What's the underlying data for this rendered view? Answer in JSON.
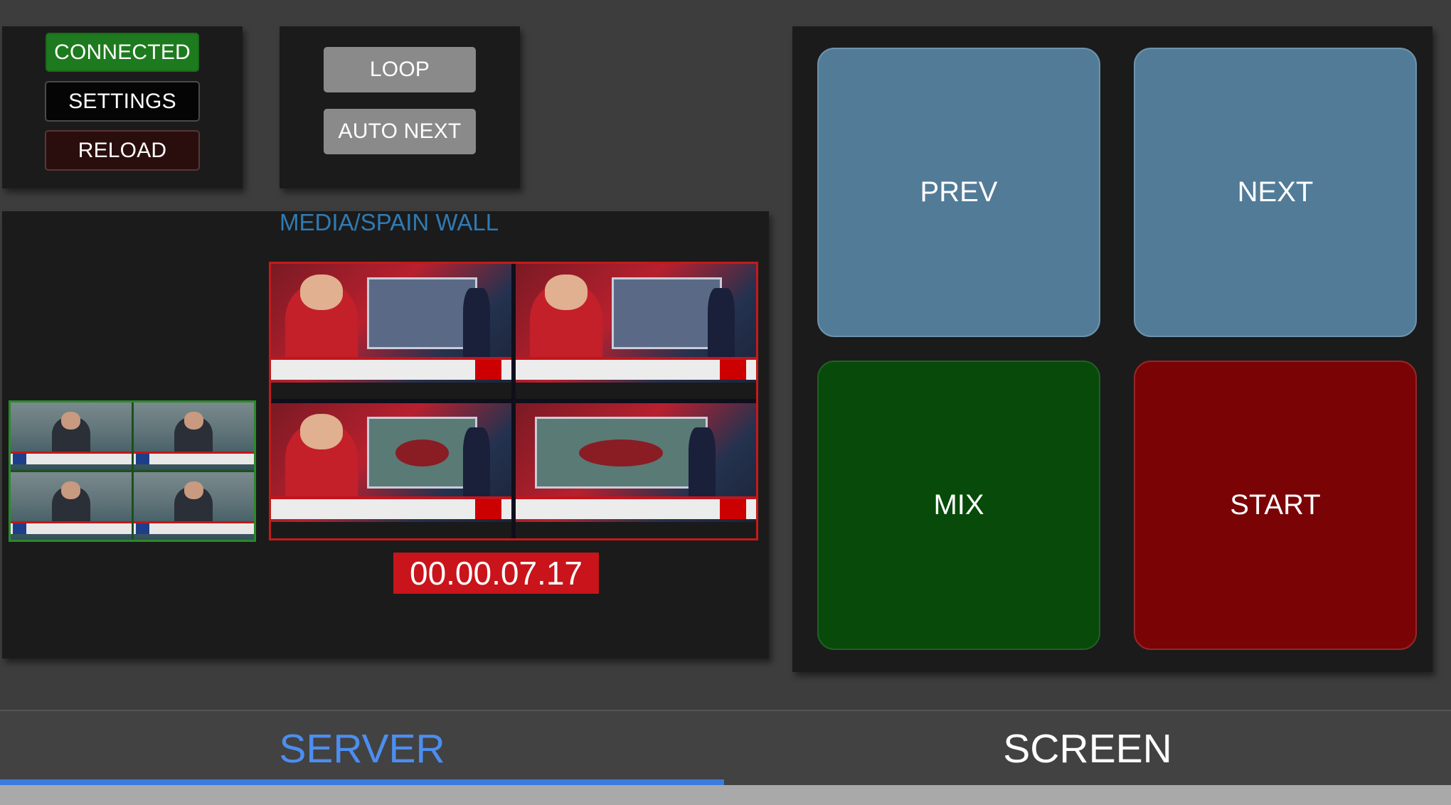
{
  "status_panel": {
    "connected_label": "CONNECTED",
    "settings_label": "SETTINGS",
    "reload_label": "RELOAD"
  },
  "playback_panel": {
    "loop_label": "LOOP",
    "auto_next_label": "AUTO NEXT"
  },
  "media": {
    "title": "MEDIA/SPAIN WALL",
    "timecode": "00.00.07.17"
  },
  "controls": {
    "prev_label": "PREV",
    "next_label": "NEXT",
    "mix_label": "MIX",
    "start_label": "START"
  },
  "tabs": [
    {
      "label": "SERVER",
      "active": true
    },
    {
      "label": "SCREEN",
      "active": false
    }
  ],
  "colors": {
    "connected": "#1e7a1e",
    "prev_next": "#527b97",
    "mix": "#074a0a",
    "start": "#7a0306",
    "timecode_bg": "#c8141a",
    "active_tab": "#4c8ef0"
  }
}
